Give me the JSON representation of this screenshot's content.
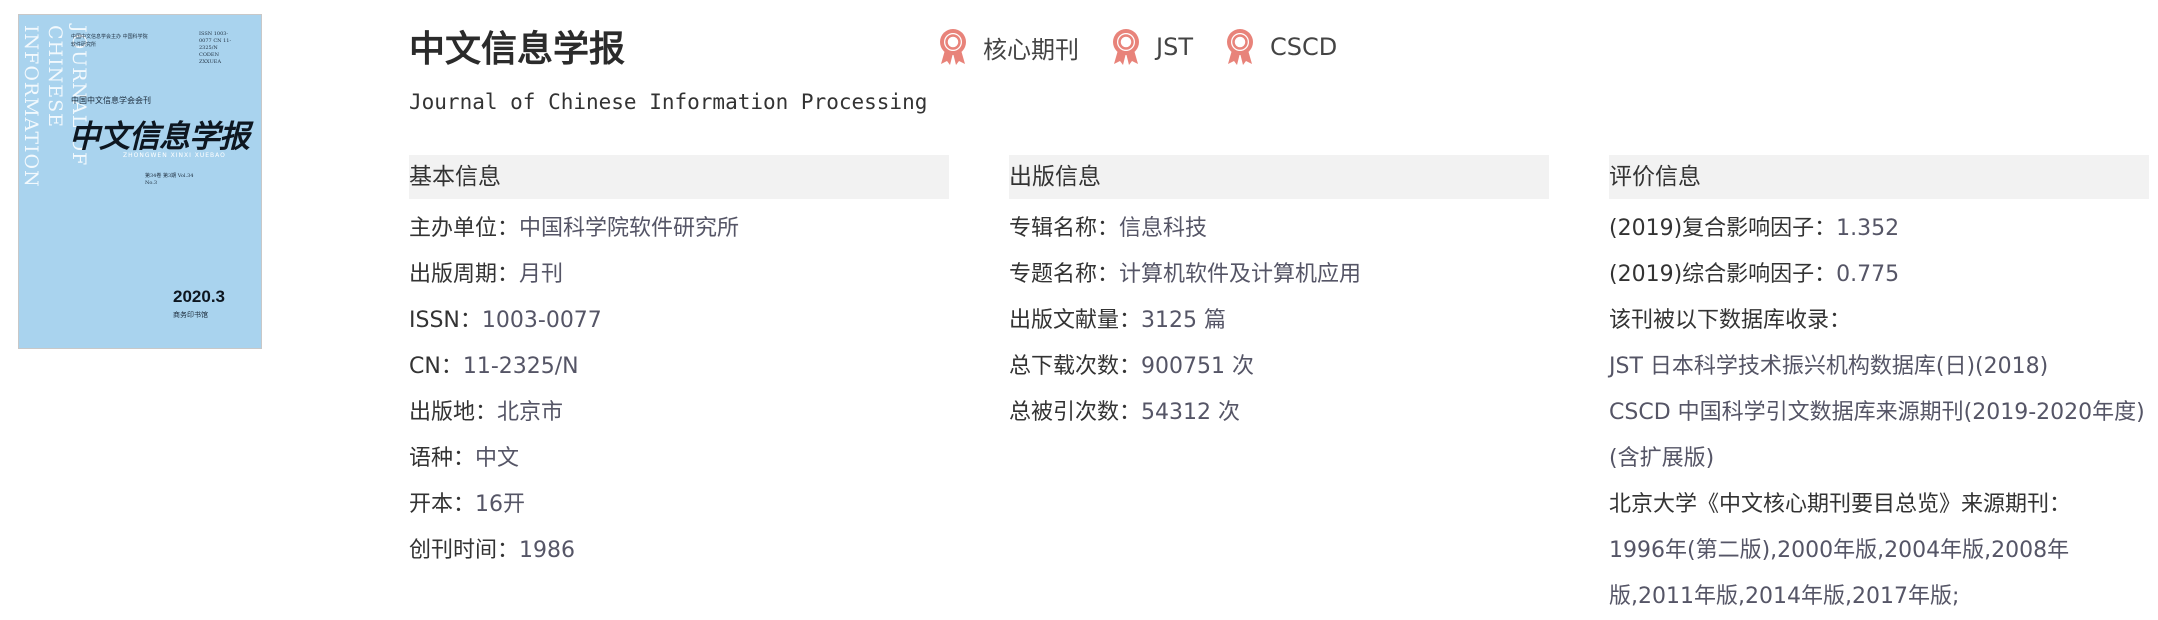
{
  "cover": {
    "vertical_text": "JOURNAL OF CHINESE INFORMATION PROCESSING",
    "header_small": "中国中文信息学会主办 中国科学院软件研究所",
    "issn_small": "ISSN 1003-0077 CN 11-2325/N CODEN ZXXUEA",
    "org": "中国中文信息学会会刊",
    "title": "中文信息学报",
    "pinyin": "ZHONGWEN XINXI XUEBAO",
    "volume": "第34卷 第3期 Vol.34 No.3",
    "date": "2020.3",
    "publisher": "商务印书馆"
  },
  "journal": {
    "title": "中文信息学报",
    "english_title": "Journal of Chinese Information Processing"
  },
  "badges": [
    {
      "label": "核心期刊",
      "icon": "award-icon"
    },
    {
      "label": "JST",
      "icon": "award-icon"
    },
    {
      "label": "CSCD",
      "icon": "award-icon"
    }
  ],
  "basic": {
    "heading": "基本信息",
    "rows": [
      {
        "label": "主办单位：",
        "value": "中国科学院软件研究所"
      },
      {
        "label": "出版周期：",
        "value": "月刊"
      },
      {
        "label": "ISSN：",
        "value": "1003-0077"
      },
      {
        "label": "CN：",
        "value": "11-2325/N"
      },
      {
        "label": "出版地：",
        "value": "北京市"
      },
      {
        "label": "语种：",
        "value": "中文"
      },
      {
        "label": "开本：",
        "value": "16开"
      },
      {
        "label": "创刊时间：",
        "value": "1986"
      }
    ]
  },
  "publishing": {
    "heading": "出版信息",
    "rows": [
      {
        "label": "专辑名称：",
        "value": "信息科技"
      },
      {
        "label": "专题名称：",
        "value": "计算机软件及计算机应用"
      },
      {
        "label": "出版文献量：",
        "value": "3125 篇"
      },
      {
        "label": "总下载次数：",
        "value": "900751 次"
      },
      {
        "label": "总被引次数：",
        "value": "54312 次"
      }
    ]
  },
  "evaluation": {
    "heading": "评价信息",
    "rows": [
      {
        "label": "(2019)复合影响因子：",
        "value": "1.352"
      },
      {
        "label": "(2019)综合影响因子：",
        "value": "0.775"
      }
    ],
    "db_heading": "该刊被以下数据库收录：",
    "databases": [
      "JST 日本科学技术振兴机构数据库(日)(2018)",
      "CSCD 中国科学引文数据库来源期刊(2019-2020年度)(含扩展版)"
    ],
    "pku_heading": "北京大学《中文核心期刊要目总览》来源期刊：",
    "pku_years": "1996年(第二版),2000年版,2004年版,2008年版,2011年版,2014年版,2017年版;"
  },
  "colors": {
    "badge_accent": "#e8837a",
    "header_bg": "#f2f2f2",
    "cover_bg": "#a9d3ee"
  }
}
